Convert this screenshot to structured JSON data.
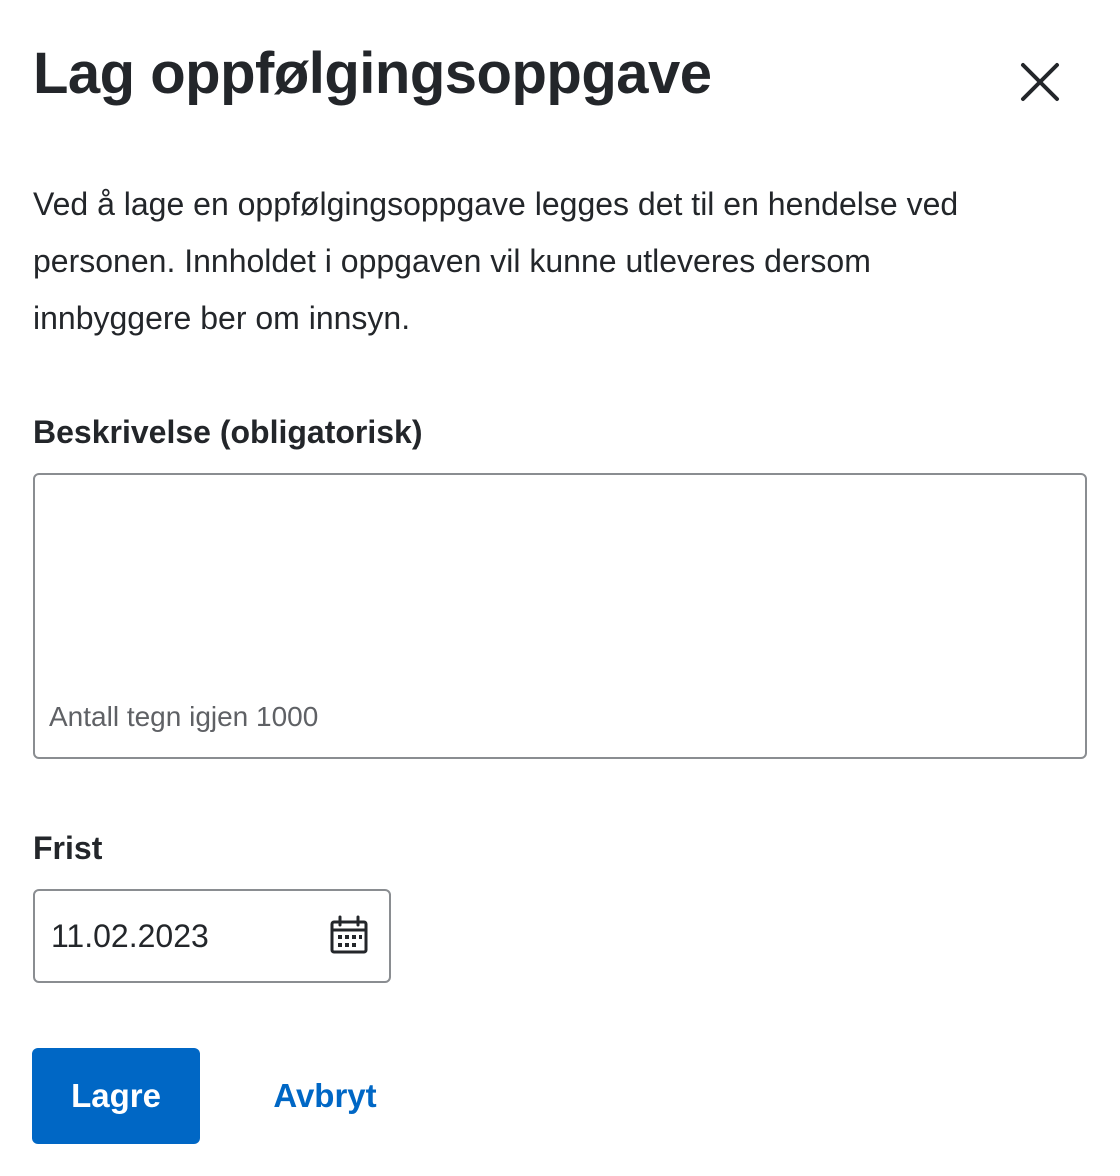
{
  "dialog": {
    "title": "Lag oppfølgingsoppgave",
    "close_icon": "close-icon",
    "intro": "Ved å lage en oppfølgingsoppgave legges det til en hendelse ved personen. Innholdet i oppgaven vil kunne utleveres dersom innbyggere ber om innsyn."
  },
  "description_field": {
    "label": "Beskrivelse (obligatorisk)",
    "value": "",
    "counter": "Antall tegn igjen 1000"
  },
  "deadline_field": {
    "label": "Frist",
    "value": "11.02.2023",
    "icon": "calendar-icon"
  },
  "actions": {
    "save_label": "Lagre",
    "cancel_label": "Avbryt"
  },
  "colors": {
    "primary": "#0067c5",
    "text": "#23262a",
    "muted": "#5f6165",
    "border": "#8a8d91"
  }
}
